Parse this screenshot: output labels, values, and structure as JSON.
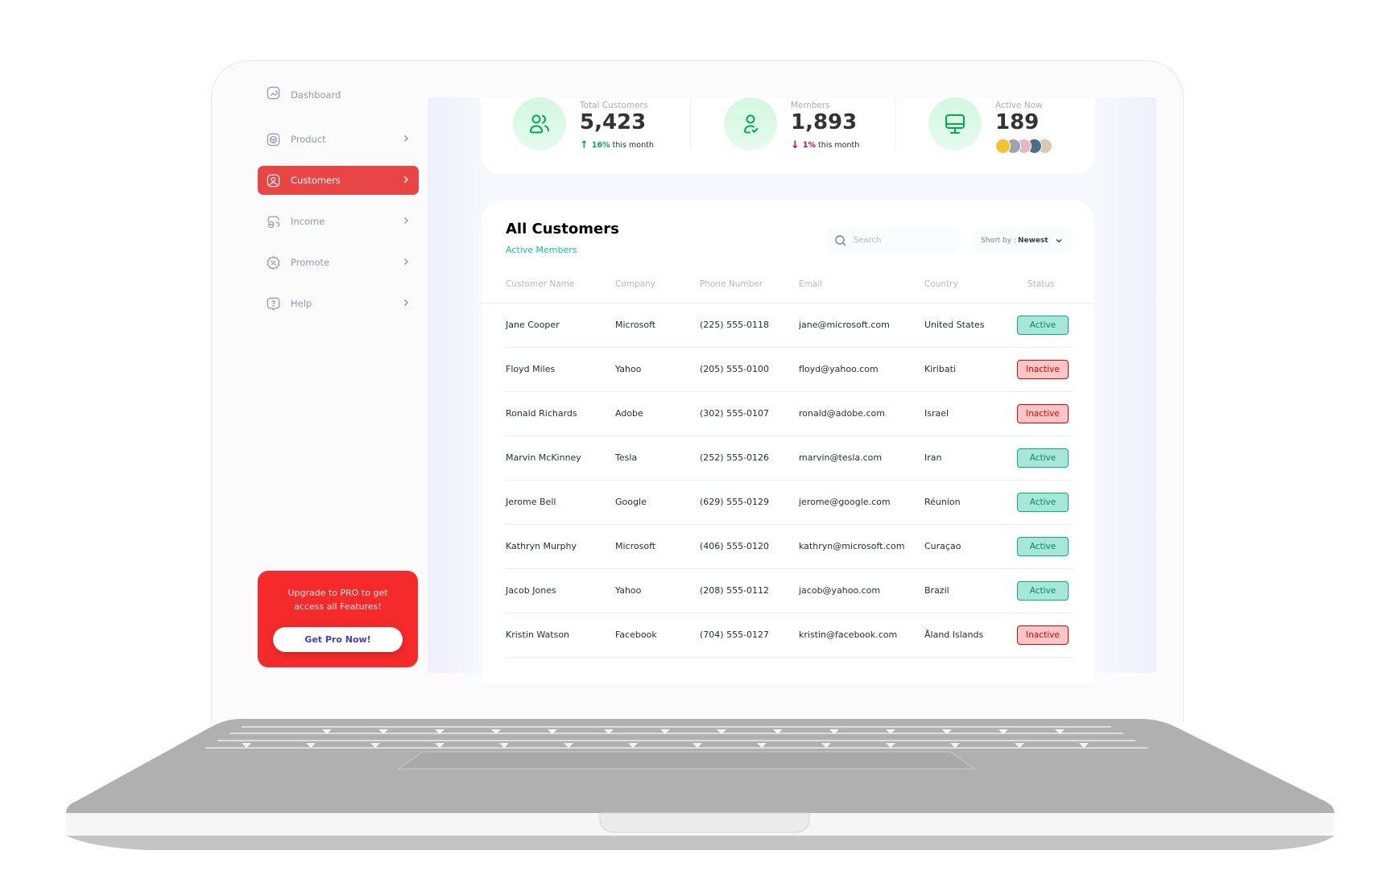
{
  "sidebar": {
    "items": [
      {
        "label": "Dashboard",
        "icon": "dashboard-icon",
        "active": false
      },
      {
        "label": "Product",
        "icon": "product-icon",
        "active": false
      },
      {
        "label": "Customers",
        "icon": "customers-icon",
        "active": true
      },
      {
        "label": "Income",
        "icon": "income-icon",
        "active": false
      },
      {
        "label": "Promote",
        "icon": "promote-icon",
        "active": false
      },
      {
        "label": "Help",
        "icon": "help-icon",
        "active": false
      }
    ],
    "upgrade": {
      "text": "Upgrade to  PRO to get access all Features!",
      "button_label": "Get Pro Now!"
    }
  },
  "stats": [
    {
      "label": "Total Customers",
      "value": "5,423",
      "trend_direction": "up",
      "trend_percent": "16%",
      "trend_suffix": "this month"
    },
    {
      "label": "Members",
      "value": "1,893",
      "trend_direction": "down",
      "trend_percent": "1%",
      "trend_suffix": "this month"
    },
    {
      "label": "Active Now",
      "value": "189",
      "avatars": [
        "#f2c230",
        "#9aa5b1",
        "#e6b8c4",
        "#4f6f86",
        "#d9c7b0"
      ]
    }
  ],
  "table": {
    "title": "All Customers",
    "subtitle": "Active Members",
    "search_placeholder": "Search",
    "sort_label": "Short by :",
    "sort_value": "Newest",
    "columns": [
      "Customer Name",
      "Company",
      "Phone Number",
      "Email",
      "Country",
      "Status"
    ],
    "rows": [
      {
        "name": "Jane Cooper",
        "company": "Microsoft",
        "phone": "(225) 555-0118",
        "email": "jane@microsoft.com",
        "country": "United States",
        "status": "Active"
      },
      {
        "name": "Floyd Miles",
        "company": "Yahoo",
        "phone": "(205) 555-0100",
        "email": "floyd@yahoo.com",
        "country": "Kiribati",
        "status": "Inactive"
      },
      {
        "name": "Ronald Richards",
        "company": "Adobe",
        "phone": "(302) 555-0107",
        "email": "ronald@adobe.com",
        "country": "Israel",
        "status": "Inactive"
      },
      {
        "name": "Marvin McKinney",
        "company": "Tesla",
        "phone": "(252) 555-0126",
        "email": "marvin@tesla.com",
        "country": "Iran",
        "status": "Active"
      },
      {
        "name": "Jerome Bell",
        "company": "Google",
        "phone": "(629) 555-0129",
        "email": "jerome@google.com",
        "country": "Réunion",
        "status": "Active"
      },
      {
        "name": "Kathryn Murphy",
        "company": "Microsoft",
        "phone": "(406) 555-0120",
        "email": "kathryn@microsoft.com",
        "country": "Curaçao",
        "status": "Active"
      },
      {
        "name": "Jacob Jones",
        "company": "Yahoo",
        "phone": "(208) 555-0112",
        "email": "jacob@yahoo.com",
        "country": "Brazil",
        "status": "Active"
      },
      {
        "name": "Kristin Watson",
        "company": "Facebook",
        "phone": "(704) 555-0127",
        "email": "kristin@facebook.com",
        "country": "Åland Islands",
        "status": "Inactive"
      }
    ]
  },
  "colors": {
    "accent_red": "#e84545",
    "upgrade_red": "#f52a2a",
    "trend_up": "#00ac4f",
    "trend_down": "#d0004b",
    "subtitle_green": "#16c098"
  }
}
